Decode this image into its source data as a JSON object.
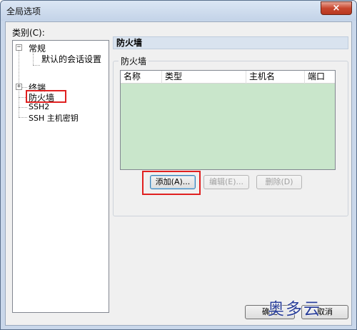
{
  "window": {
    "title": "全局选项",
    "close_icon": "×"
  },
  "category_label": "类别(C):",
  "tree": {
    "items": [
      {
        "label": "常规",
        "expander": "−"
      },
      {
        "label": "默认的会话设置"
      },
      {
        "label": "终端",
        "expander": "+"
      },
      {
        "label": "防火墙"
      },
      {
        "label": "SSH2"
      },
      {
        "label": "SSH 主机密钥"
      }
    ]
  },
  "panel": {
    "header": "防火墙",
    "group_label": "防火墙"
  },
  "list": {
    "columns": [
      "名称",
      "类型",
      "主机名",
      "端口"
    ]
  },
  "buttons": {
    "add": "添加(A)...",
    "edit": "编辑(E)...",
    "delete": "删除(D)",
    "ok": "确定",
    "cancel": "取消"
  },
  "watermark": "奥多云",
  "colors": {
    "highlight": "#e02020",
    "list_bg": "#c9e6cb"
  }
}
